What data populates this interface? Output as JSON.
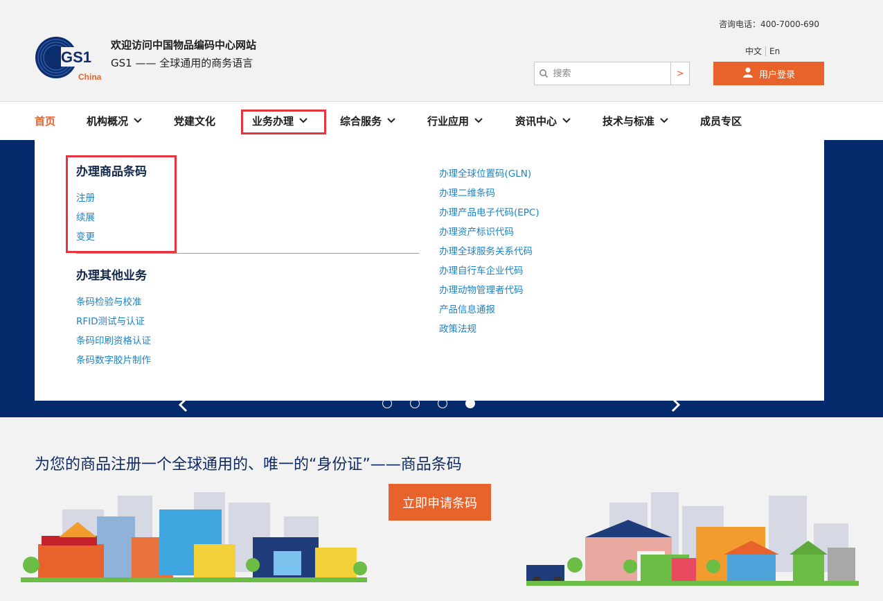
{
  "header": {
    "logo_text": "GS1",
    "logo_sub": "China",
    "site_title": "欢迎访问中国物品编码中心网站",
    "site_subtitle": "GS1 —— 全球通用的商务语言",
    "hotline": "咨询电话：400-7000-690",
    "lang_cn": "中文",
    "lang_en": "En",
    "search_placeholder": "搜索",
    "search_go": ">",
    "login_label": "用户登录"
  },
  "nav": {
    "items": [
      {
        "label": "首页",
        "active": true,
        "dropdown": false
      },
      {
        "label": "机构概况",
        "dropdown": true
      },
      {
        "label": "党建文化",
        "dropdown": false
      },
      {
        "label": "业务办理",
        "dropdown": true,
        "open": true
      },
      {
        "label": "综合服务",
        "dropdown": true
      },
      {
        "label": "行业应用",
        "dropdown": true
      },
      {
        "label": "资讯中心",
        "dropdown": true
      },
      {
        "label": "技术与标准",
        "dropdown": true
      },
      {
        "label": "成员专区",
        "dropdown": false
      }
    ]
  },
  "dropdown": {
    "group1_title": "办理商品条码",
    "group1_links": [
      "注册",
      "续展",
      "变更"
    ],
    "group2_title": "办理其他业务",
    "group2_links": [
      "条码检验与校准",
      "RFID测试与认证",
      "条码印刷资格认证",
      "条码数字胶片制作"
    ],
    "right_links": [
      "办理全球位置码(GLN)",
      "办理二维条码",
      "办理产品电子代码(EPC)",
      "办理资产标识代码",
      "办理全球服务关系代码",
      "办理自行车企业代码",
      "办理动物管理者代码",
      "产品信息通报",
      "政策法规"
    ]
  },
  "banner": {
    "slide_count": 4,
    "active_slide": 4
  },
  "promo": {
    "slogan": "为您的商品注册一个全球通用的、唯一的“身份证”——商品条码",
    "apply_label": "立即申请条码"
  },
  "colors": {
    "accent": "#e8632c",
    "navy": "#052a6b",
    "link": "#1e83c4",
    "highlight": "#e8343f"
  }
}
